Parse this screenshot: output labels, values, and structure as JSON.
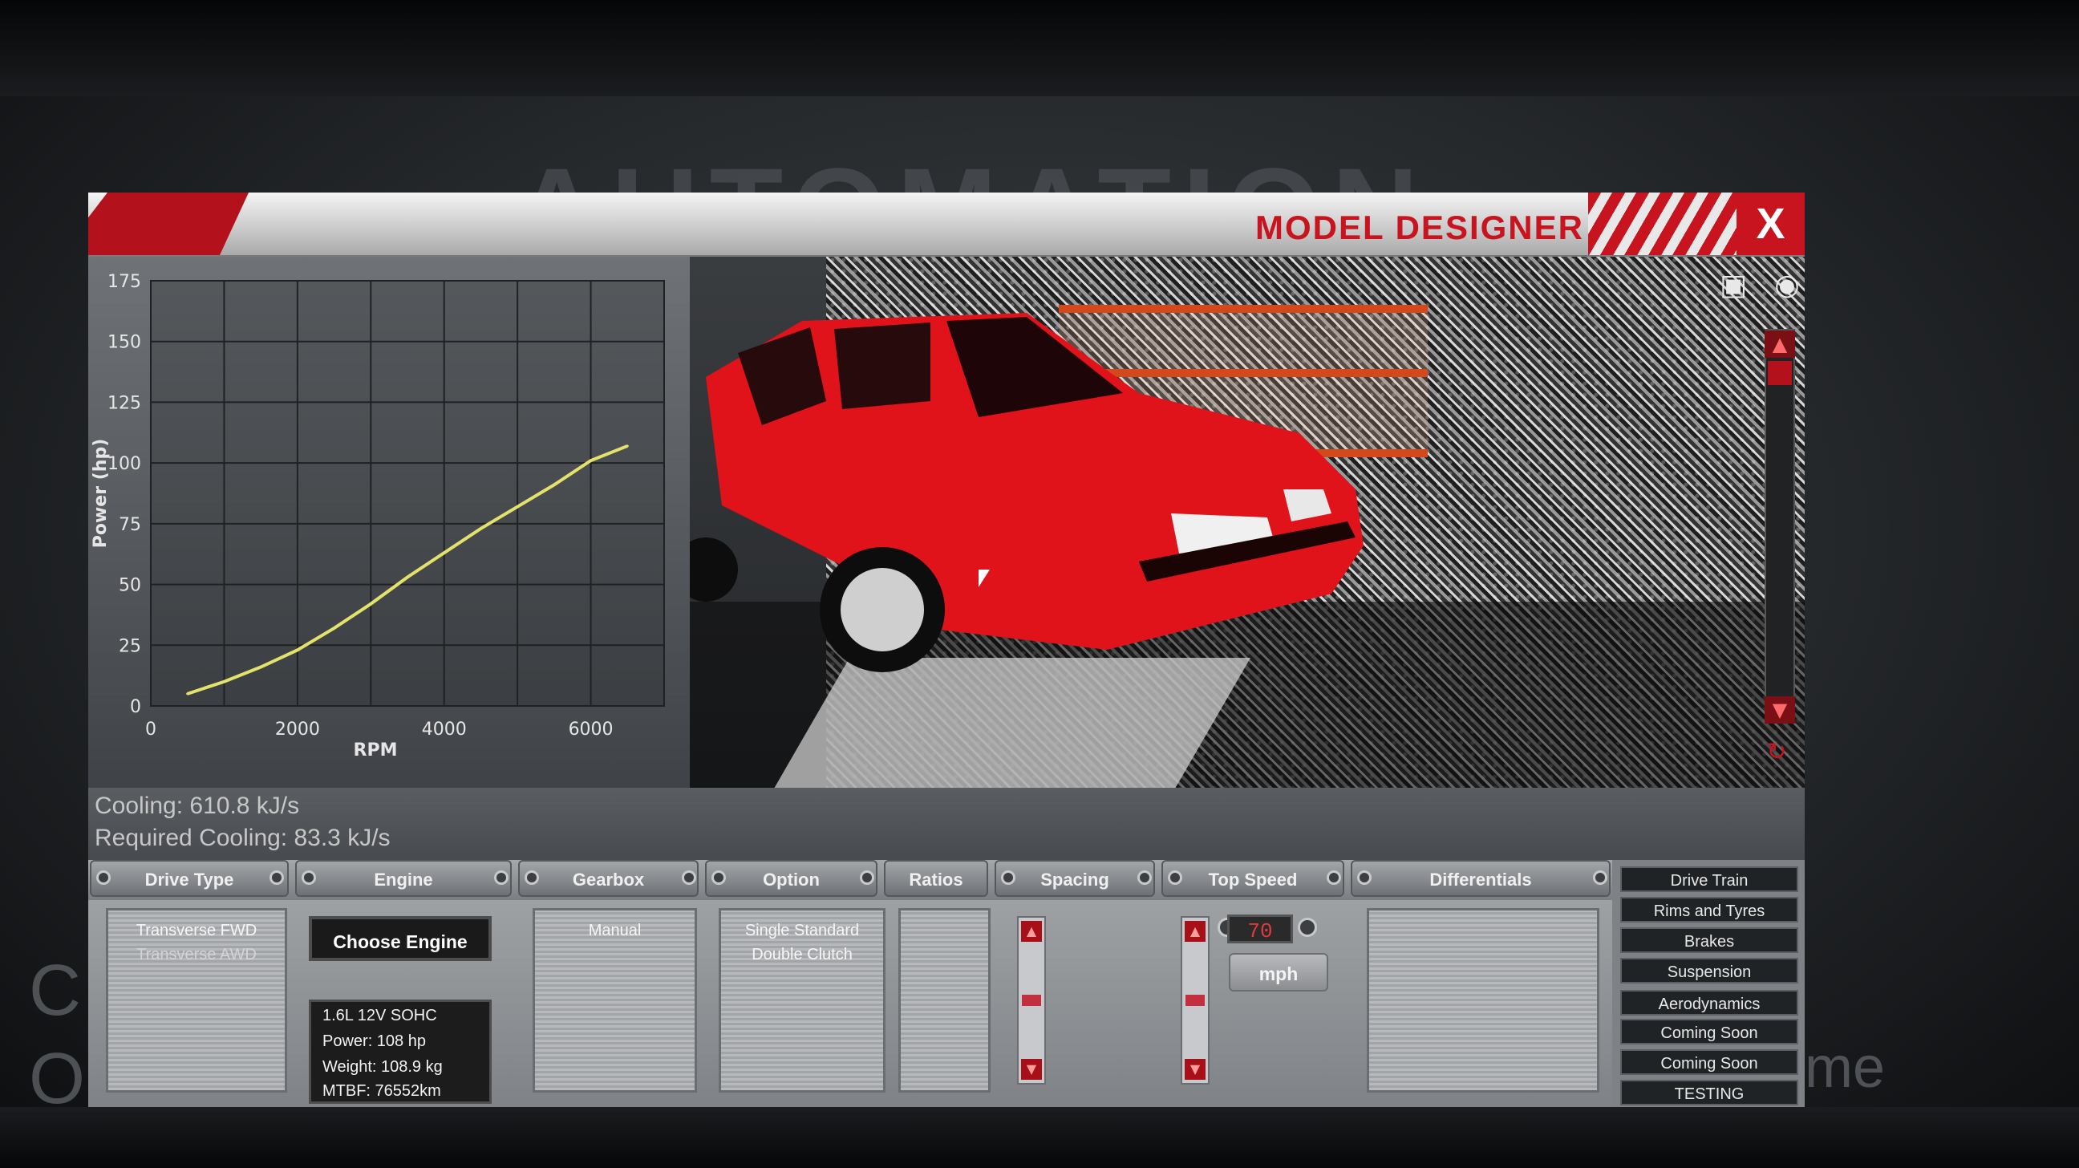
{
  "window": {
    "title": "MODEL DESIGNER",
    "close_label": "X"
  },
  "background": {
    "logo_text": "AUTOMATION",
    "left_text": "C\nO",
    "right_text": "me"
  },
  "chart_data": {
    "type": "line",
    "title": "",
    "xlabel": "RPM",
    "ylabel": "Power (hp)",
    "xlim": [
      0,
      7000
    ],
    "ylim": [
      0,
      175
    ],
    "xticks": [
      0,
      2000,
      4000,
      6000
    ],
    "yticks": [
      0,
      25,
      50,
      75,
      100,
      125,
      150,
      175
    ],
    "grid": true,
    "series": [
      {
        "color": "#e3e26a",
        "x": [
          500,
          1000,
          1500,
          2000,
          2500,
          3000,
          3500,
          4000,
          4500,
          5000,
          5500,
          6000,
          6500
        ],
        "y": [
          5,
          10,
          16,
          23,
          32,
          42,
          53,
          63,
          73,
          82,
          91,
          101,
          107
        ]
      }
    ]
  },
  "stats": {
    "cooling": "Cooling: 610.8 kJ/s",
    "required_cooling": "Required Cooling: 83.3 kJ/s"
  },
  "tabs": [
    "Drive Type",
    "Engine",
    "Gearbox",
    "Option",
    "Ratios",
    "Spacing",
    "Top Speed",
    "Differentials"
  ],
  "drive_type": {
    "options": [
      "Transverse FWD",
      "Transverse AWD"
    ]
  },
  "engine": {
    "choose_label": "Choose Engine",
    "name": "1.6L 12V SOHC",
    "power": "Power: 108 hp",
    "weight": "Weight: 108.9 kg",
    "mtbf": "MTBF: 76552km"
  },
  "gearbox": {
    "options": [
      "Manual"
    ]
  },
  "option": {
    "options": [
      "Single Standard",
      "Double Clutch"
    ]
  },
  "top_speed": {
    "value": "70",
    "unit": "mph"
  },
  "side_menu": [
    "Drive Train",
    "Rims and Tyres",
    "Brakes",
    "Suspension",
    "Aerodynamics",
    "Coming Soon",
    "Coming Soon",
    "TESTING"
  ],
  "colors": {
    "accent": "#c8141e",
    "curve": "#e3e26a",
    "panel": "#a5a8ab"
  },
  "icons": {
    "camera": "camera-icon",
    "eye": "eye-icon",
    "rotate": "rotate-icon"
  }
}
